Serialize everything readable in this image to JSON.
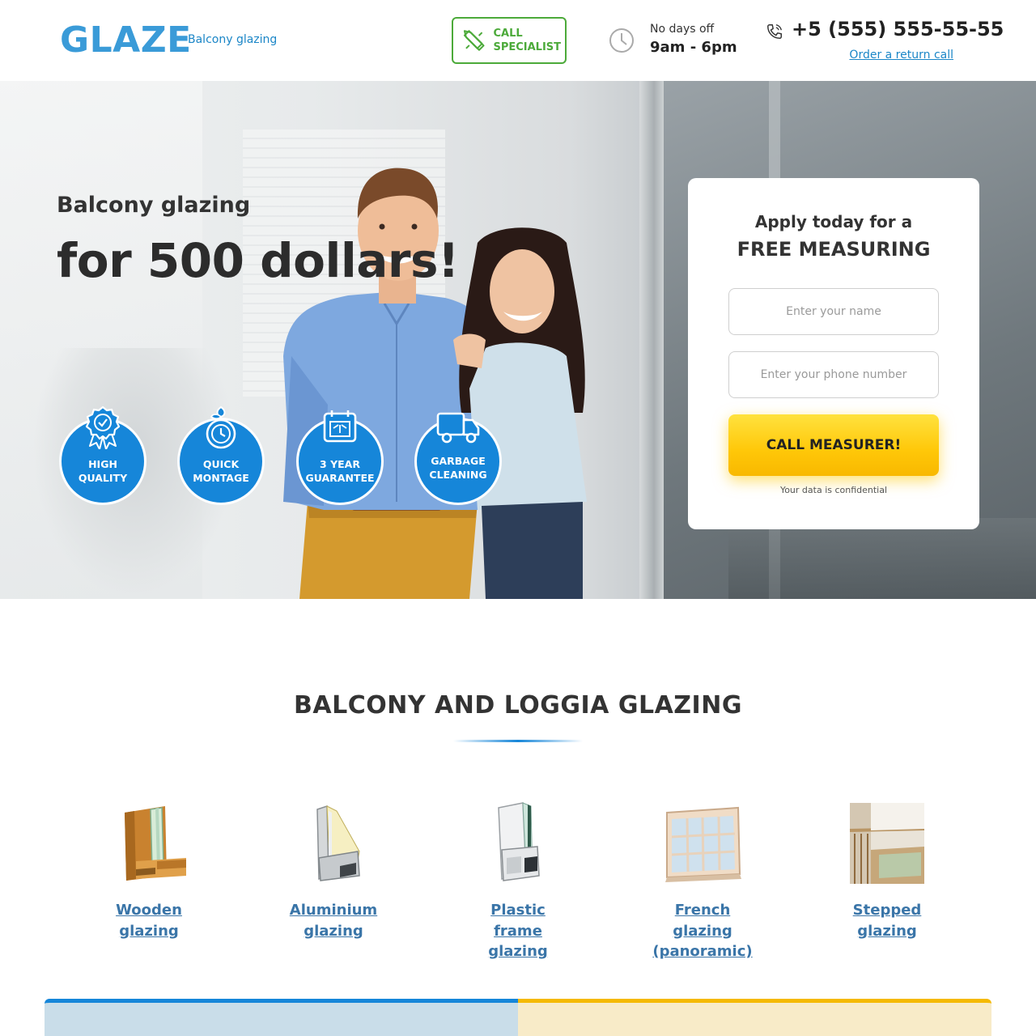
{
  "header": {
    "logo": "GLAZE",
    "tagline": "Balcony glazing",
    "call_specialist": "CALL SPECIALIST",
    "hours_label": "No days off",
    "hours_value": "9am - 6pm",
    "phone": "+5 (555) 555-55-55",
    "return_call": "Order a return call"
  },
  "hero": {
    "subtitle": "Balcony glazing",
    "title": "for 500 dollars!",
    "badges": [
      {
        "label_line1": "HIGH",
        "label_line2": "QUALITY",
        "icon": "award-ribbon-icon"
      },
      {
        "label_line1": "QUICK",
        "label_line2": "MONTAGE",
        "icon": "clock-icon"
      },
      {
        "label_line1": "3 YEAR",
        "label_line2": "GUARANTEE",
        "icon": "certificate-icon"
      },
      {
        "label_line1": "GARBAGE",
        "label_line2": "CLEANING",
        "icon": "truck-icon"
      }
    ]
  },
  "form": {
    "title_line1": "Apply today for a",
    "title_line2": "FREE MEASURING",
    "name_placeholder": "Enter your name",
    "phone_placeholder": "Enter your phone number",
    "submit": "CALL MEASURER!",
    "note": "Your data is confidential"
  },
  "section": {
    "title": "BALCONY AND LOGGIA GLAZING",
    "products": [
      {
        "lines": [
          "Wooden",
          "glazing"
        ],
        "icon": "wooden-window-profile-icon"
      },
      {
        "lines": [
          "Aluminium",
          "glazing"
        ],
        "icon": "aluminium-window-profile-icon"
      },
      {
        "lines": [
          "Plastic",
          "frame",
          "glazing"
        ],
        "icon": "plastic-window-profile-icon"
      },
      {
        "lines": [
          "French",
          "glazing",
          "(panoramic)"
        ],
        "icon": "panoramic-window-icon"
      },
      {
        "lines": [
          "Stepped",
          "glazing"
        ],
        "icon": "stepped-balcony-icon"
      }
    ]
  },
  "colors": {
    "accent_blue": "#1686d9",
    "logo_blue": "#3a9bd8",
    "green": "#4caa3a",
    "button_yellow": "#ffc708"
  }
}
